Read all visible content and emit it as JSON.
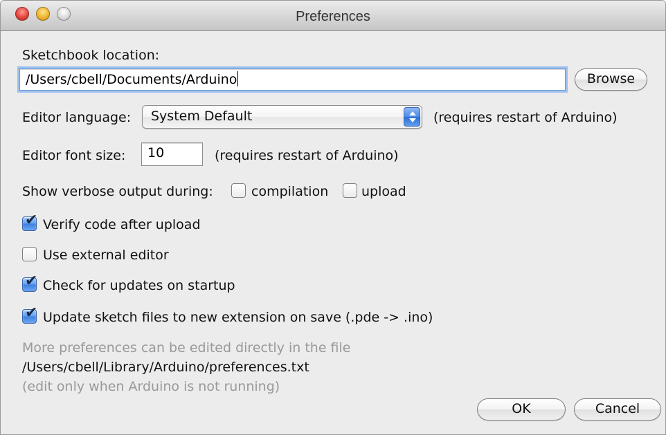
{
  "window": {
    "title": "Preferences"
  },
  "sketchbook": {
    "label": "Sketchbook location:",
    "path": "/Users/cbell/Documents/Arduino",
    "browse_label": "Browse"
  },
  "language": {
    "label": "Editor language:",
    "selected": "System Default",
    "note": "(requires restart of Arduino)"
  },
  "font_size": {
    "label": "Editor font size:",
    "value": "10",
    "note": "(requires restart of Arduino)"
  },
  "verbose": {
    "label": "Show verbose output during:",
    "compilation_label": "compilation",
    "compilation_checked": false,
    "upload_label": "upload",
    "upload_checked": false
  },
  "options": [
    {
      "label": "Verify code after upload",
      "checked": true
    },
    {
      "label": "Use external editor",
      "checked": false
    },
    {
      "label": "Check for updates on startup",
      "checked": true
    },
    {
      "label": "Update sketch files to new extension on save (.pde -> .ino)",
      "checked": true
    }
  ],
  "footer": {
    "more_prefs": "More preferences can be edited directly in the file",
    "file_path": "/Users/cbell/Library/Arduino/preferences.txt",
    "edit_note": "(edit only when Arduino is not running)"
  },
  "buttons": {
    "ok": "OK",
    "cancel": "Cancel"
  },
  "icons": {
    "check": "✔"
  }
}
